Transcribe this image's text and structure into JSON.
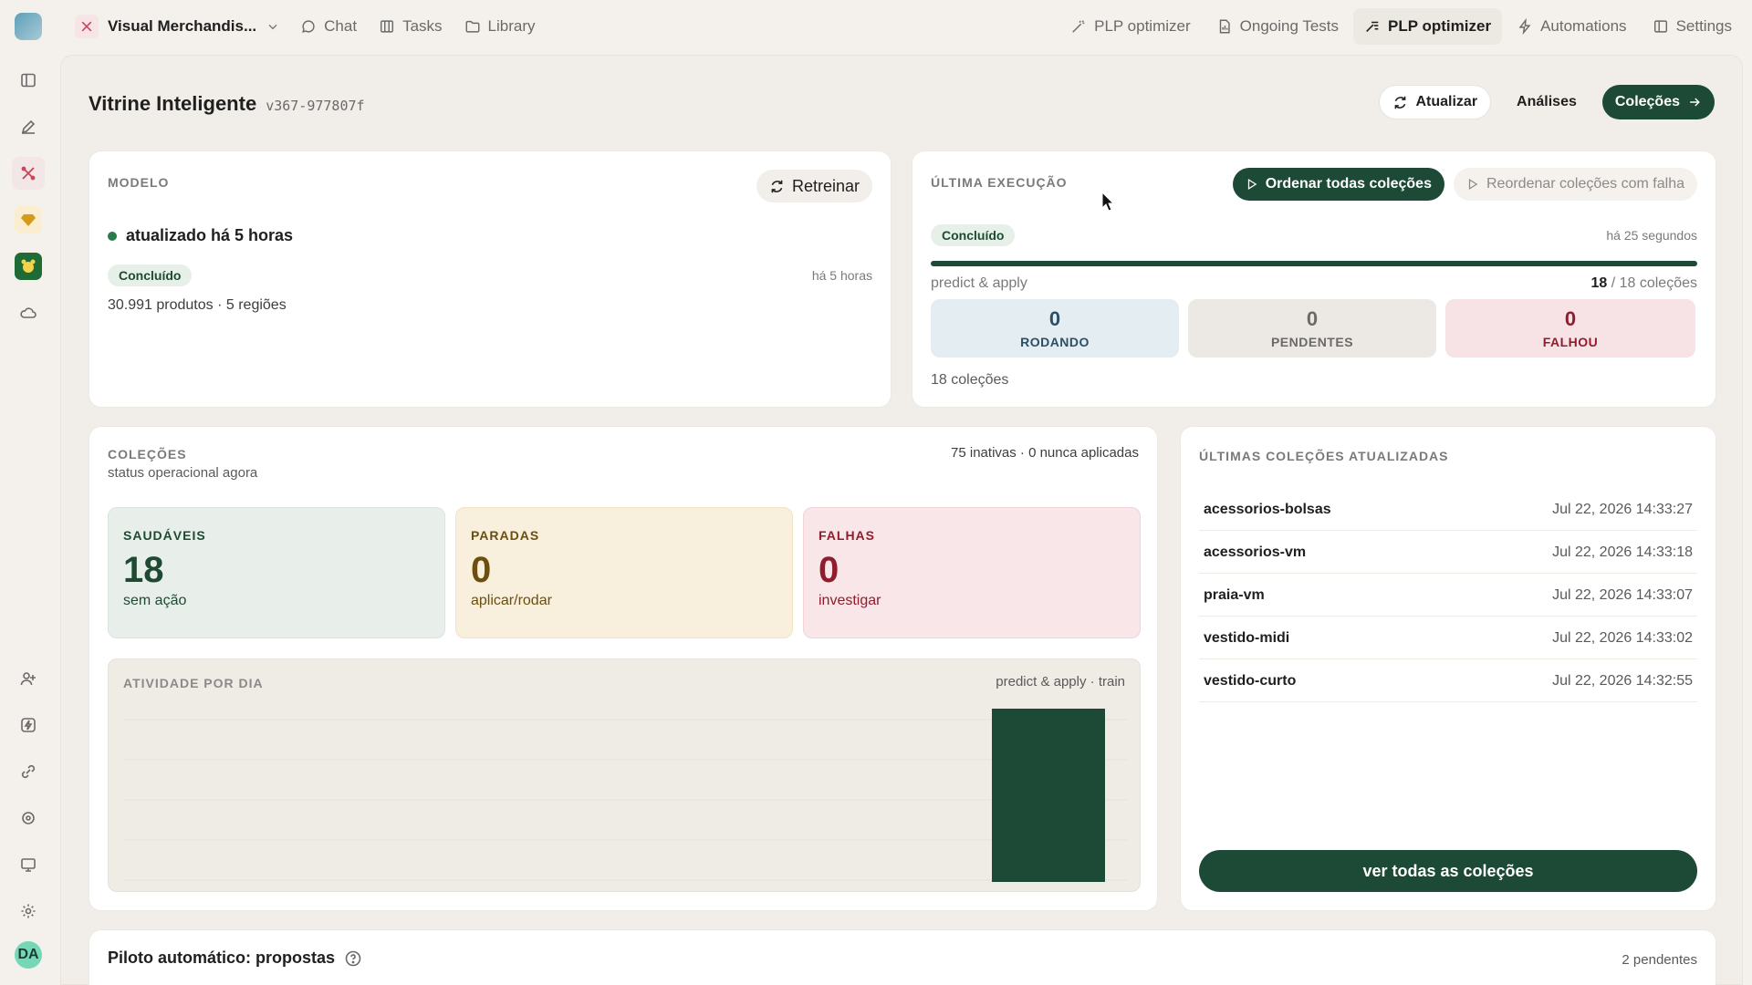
{
  "workspace": {
    "name": "Visual Merchandis..."
  },
  "nav": {
    "left": [
      "Chat",
      "Tasks",
      "Library"
    ],
    "right": [
      "PLP optimizer",
      "Ongoing Tests",
      "PLP optimizer",
      "Automations",
      "Settings"
    ]
  },
  "user": {
    "initials": "DA"
  },
  "page": {
    "title": "Vitrine Inteligente",
    "version": "v367-977807f",
    "actions": {
      "refresh": "Atualizar",
      "analyses": "Análises",
      "collections": "Coleções"
    }
  },
  "model": {
    "heading": "MODELO",
    "retrain": "Retreinar",
    "status": "atualizado há 5 horas",
    "pill": "Concluído",
    "when": "há 5 horas",
    "summary": "30.991 produtos · 5 regiões"
  },
  "execution": {
    "heading": "ÚLTIMA EXECUÇÃO",
    "primary_action": "Ordenar todas coleções",
    "secondary_action": "Reordenar coleções com falha",
    "pill": "Concluído",
    "when": "há 25 segundos",
    "stage": "predict & apply",
    "done": "18",
    "total": " / 18 coleções",
    "progress_fraction": 1.0,
    "running": {
      "value": "0",
      "label": "RODANDO"
    },
    "pending": {
      "value": "0",
      "label": "PENDENTES"
    },
    "failed": {
      "value": "0",
      "label": "FALHOU"
    },
    "footer": "18 coleções"
  },
  "collections": {
    "heading": "COLEÇÕES",
    "sub": "status operacional agora",
    "summary": "75 inativas · 0 nunca aplicadas",
    "healthy": {
      "title": "SAUDÁVEIS",
      "value": "18",
      "note": "sem ação"
    },
    "stopped": {
      "title": "PARADAS",
      "value": "0",
      "note": "aplicar/rodar"
    },
    "failures": {
      "title": "FALHAS",
      "value": "0",
      "note": "investigar"
    },
    "activity": {
      "heading": "ATIVIDADE POR DIA",
      "legend": "predict & apply · train"
    }
  },
  "chart_data": {
    "type": "bar",
    "title": "ATIVIDADE POR DIA",
    "legend": "predict & apply · train",
    "values": [
      0,
      0,
      0,
      0,
      0,
      0,
      0,
      0,
      0,
      0,
      0,
      1
    ],
    "grid": true
  },
  "recent": {
    "heading": "ÚLTIMAS COLEÇÕES ATUALIZADAS",
    "items": [
      {
        "name": "acessorios-bolsas",
        "date": "Jul 22, 2026 14:33:27"
      },
      {
        "name": "acessorios-vm",
        "date": "Jul 22, 2026 14:33:18"
      },
      {
        "name": "praia-vm",
        "date": "Jul 22, 2026 14:33:07"
      },
      {
        "name": "vestido-midi",
        "date": "Jul 22, 2026 14:33:02"
      },
      {
        "name": "vestido-curto",
        "date": "Jul 22, 2026 14:32:55"
      }
    ],
    "cta": "ver todas as coleções"
  },
  "autopilot": {
    "title": "Piloto automático: propostas",
    "count": "2 pendentes"
  },
  "colors": {
    "accent": "#1d4a36",
    "danger": "#8f1d2c",
    "warning": "#7a5a10"
  }
}
